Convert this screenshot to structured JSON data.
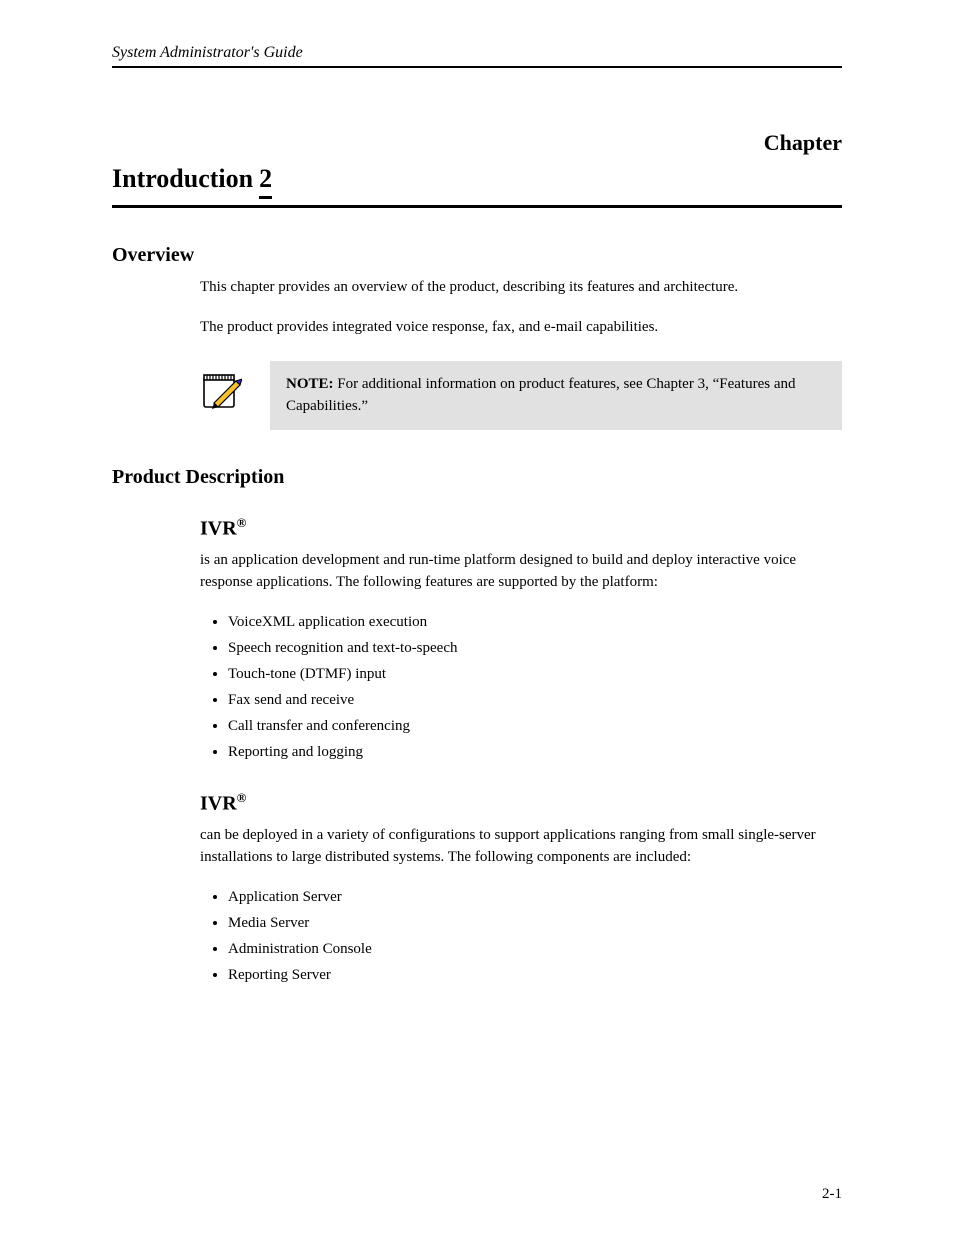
{
  "header": {
    "running": "System Administrator's Guide"
  },
  "chapter": {
    "label": "Chapter",
    "number": "2",
    "title": "Introduction"
  },
  "sections": {
    "overview": {
      "heading": "Overview",
      "p1": "This chapter provides an overview of the product, describing its features and architecture.",
      "p2": "The product provides integrated voice response, fax, and e-mail capabilities."
    },
    "note": {
      "label": "NOTE:",
      "text_before_quote": " For additional information on product features, see Chapter 3, ",
      "quoted": "“Features and Capabilities.”"
    },
    "desc": {
      "heading": "Product Description",
      "p1_before_reg": "",
      "p1_brand": "IVR",
      "p1_after_reg": " is an application development and run-time platform designed to build and deploy interactive voice response applications. The following features are supported by the platform:",
      "list1": [
        "VoiceXML application execution",
        "Speech recognition and text-to-speech",
        "Touch-tone (DTMF) input",
        "Fax send and receive",
        "Call transfer and conferencing",
        "Reporting and logging"
      ],
      "p2_before_reg": "",
      "p2_brand": "IVR",
      "p2_after_reg": " can be deployed in a variety of configurations to support applications ranging from small single-server installations to large distributed systems. The following components are included:",
      "list2": [
        "Application Server",
        "Media Server",
        "Administration Console",
        "Reporting Server"
      ]
    }
  },
  "page_number": "2-1"
}
